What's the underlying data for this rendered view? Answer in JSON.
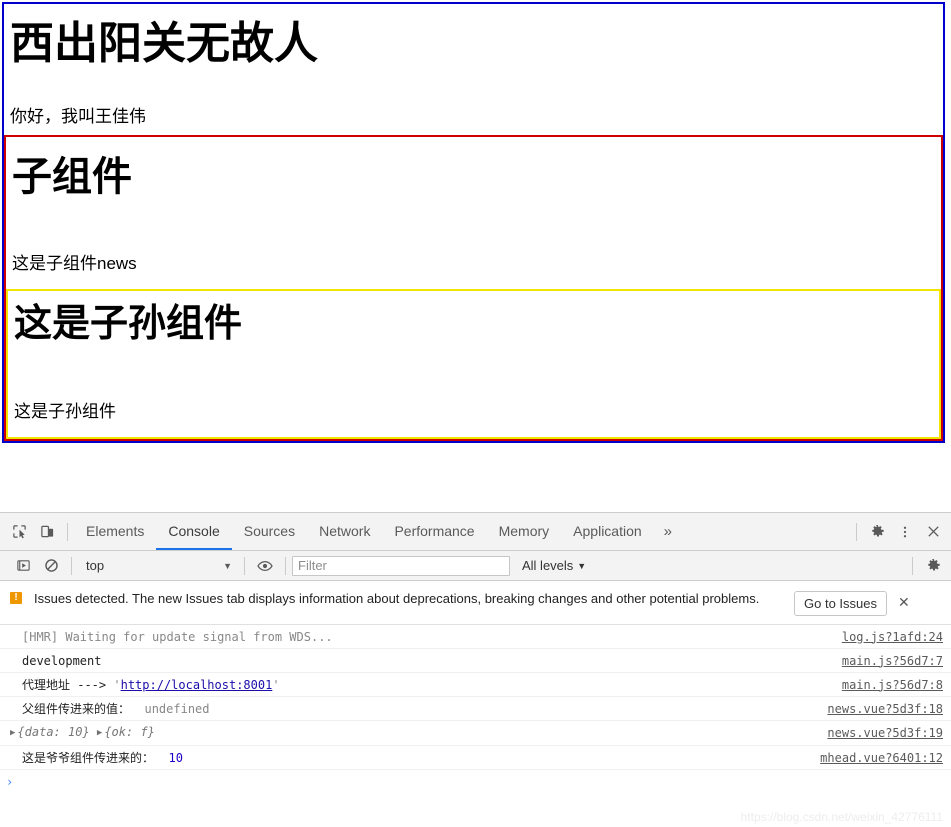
{
  "page": {
    "app": {
      "title": "西出阳关无故人",
      "subtitle": "你好，我叫王佳伟",
      "border_color": "#0000cd"
    },
    "child": {
      "title": "子组件",
      "subtitle": "这是子组件news",
      "border_color": "#cc0000"
    },
    "grandchild": {
      "title": "这是子孙组件",
      "subtitle": "这是子孙组件",
      "border_color": "#f2e500"
    }
  },
  "devtools": {
    "icons": {
      "inspect": "inspect-element-icon",
      "device": "device-toolbar-icon",
      "settings": "gear-icon",
      "more": "more-vertical-icon",
      "close": "close-icon",
      "execute": "execute-icon",
      "clear": "clear-console-icon",
      "eye": "eye-icon"
    },
    "tabs": [
      {
        "label": "Elements",
        "active": false
      },
      {
        "label": "Console",
        "active": true
      },
      {
        "label": "Sources",
        "active": false
      },
      {
        "label": "Network",
        "active": false
      },
      {
        "label": "Performance",
        "active": false
      },
      {
        "label": "Memory",
        "active": false
      },
      {
        "label": "Application",
        "active": false
      }
    ],
    "more_tabs_label": "»",
    "filterbar": {
      "context": "top",
      "context_caret": "▼",
      "filter_placeholder": "Filter",
      "filter_value": "",
      "levels_label": "All levels",
      "levels_caret": "▼"
    },
    "issues": {
      "icon_glyph": "!",
      "text": "Issues detected. The new Issues tab displays information about deprecations, breaking changes and other potential problems.",
      "button_label": "Go to Issues",
      "close_label": "✕",
      "accent": "#ef9700"
    },
    "logs": [
      {
        "text": "[HMR] Waiting for update signal from WDS...",
        "source": "log.js?1afd:24",
        "style": "dim"
      },
      {
        "text": "development",
        "source": "main.js?56d7:7",
        "style": "plain"
      },
      {
        "text": "代理地址 ---> ",
        "link": "http://localhost:8001",
        "quote": "'",
        "source": "main.js?56d7:8",
        "style": "link"
      },
      {
        "text": "父组件传进来的值：",
        "value": "undefined",
        "source": "news.vue?5d3f:18",
        "style": "value-dim"
      },
      {
        "objects": [
          {
            "preview": "{data: 10}"
          },
          {
            "preview": "{ok: f}"
          }
        ],
        "source": "news.vue?5d3f:19",
        "style": "objects"
      },
      {
        "text": "这是爷爷组件传进来的：",
        "value": "10",
        "source": "mhead.vue?6401:12",
        "style": "value-num"
      }
    ],
    "prompt": "›"
  },
  "watermark": "https://blog.csdn.net/weixin_42776111"
}
